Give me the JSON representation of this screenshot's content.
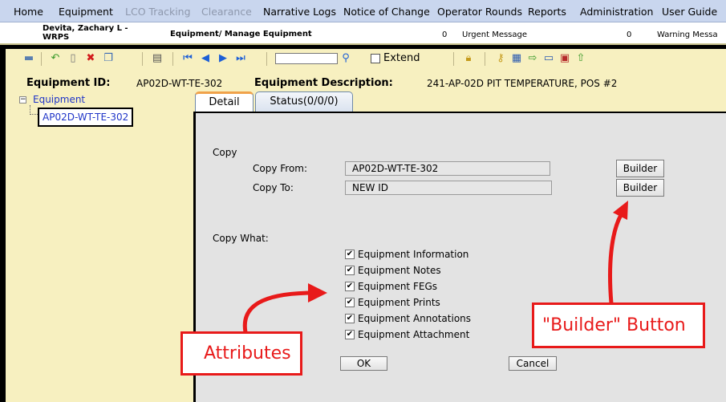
{
  "menu": [
    {
      "label": "Home",
      "disabled": false
    },
    {
      "label": "Equipment",
      "disabled": false
    },
    {
      "label": "LCO Tracking",
      "disabled": true
    },
    {
      "label": "Clearance",
      "disabled": true
    },
    {
      "label": "Narrative Logs",
      "disabled": false
    },
    {
      "label": "Notice of Change",
      "disabled": false
    },
    {
      "label": "Operator Rounds",
      "disabled": false
    },
    {
      "label": "Reports",
      "disabled": false
    },
    {
      "label": "Administration",
      "disabled": false
    },
    {
      "label": "User Guide",
      "disabled": false
    }
  ],
  "user": {
    "name": "Devita, Zachary L - WRPS",
    "breadcrumb": "Equipment/ Manage Equipment",
    "urgent_count": "0",
    "urgent_label": "Urgent Message",
    "warning_count": "0",
    "warning_label": "Warning Messa"
  },
  "toolbar": {
    "icons": [
      "save-icon",
      "undo-icon",
      "new-icon",
      "delete-icon",
      "copy-icon",
      "print-icon",
      "first-icon",
      "prev-icon",
      "next-icon",
      "last-icon",
      "search-icon",
      "lock-icon",
      "key-icon",
      "grid-icon",
      "export-icon",
      "document-icon",
      "report-icon",
      "upload-icon"
    ],
    "search_value": "",
    "extend_label": "Extend",
    "extend_checked": false
  },
  "header": {
    "id_label": "Equipment ID:",
    "id_value": "AP02D-WT-TE-302",
    "desc_label": "Equipment Description:",
    "desc_value": "241-AP-02D PIT TEMPERATURE, POS #2"
  },
  "tree": {
    "root": "Equipment",
    "expander": "−",
    "child": "AP02D-WT-TE-302"
  },
  "tabs": [
    {
      "label": "Detail",
      "active": true
    },
    {
      "label": "Status(0/0/0)",
      "active": false
    }
  ],
  "copy": {
    "section_label": "Copy",
    "from_label": "Copy From:",
    "from_value": "AP02D-WT-TE-302",
    "to_label": "Copy To:",
    "to_value": "NEW ID",
    "builder_label": "Builder",
    "what_label": "Copy What:",
    "options": [
      {
        "label": "Equipment Information",
        "checked": true
      },
      {
        "label": "Equipment Notes",
        "checked": true
      },
      {
        "label": "Equipment FEGs",
        "checked": true
      },
      {
        "label": "Equipment Prints",
        "checked": true
      },
      {
        "label": "Equipment Annotations",
        "checked": true
      },
      {
        "label": "Equipment Attachment",
        "checked": true
      }
    ],
    "ok_label": "OK",
    "cancel_label": "Cancel"
  },
  "annotations": {
    "attributes": "Attributes",
    "builder_button": "\"Builder\" Button",
    "color": "#e81a1a"
  }
}
